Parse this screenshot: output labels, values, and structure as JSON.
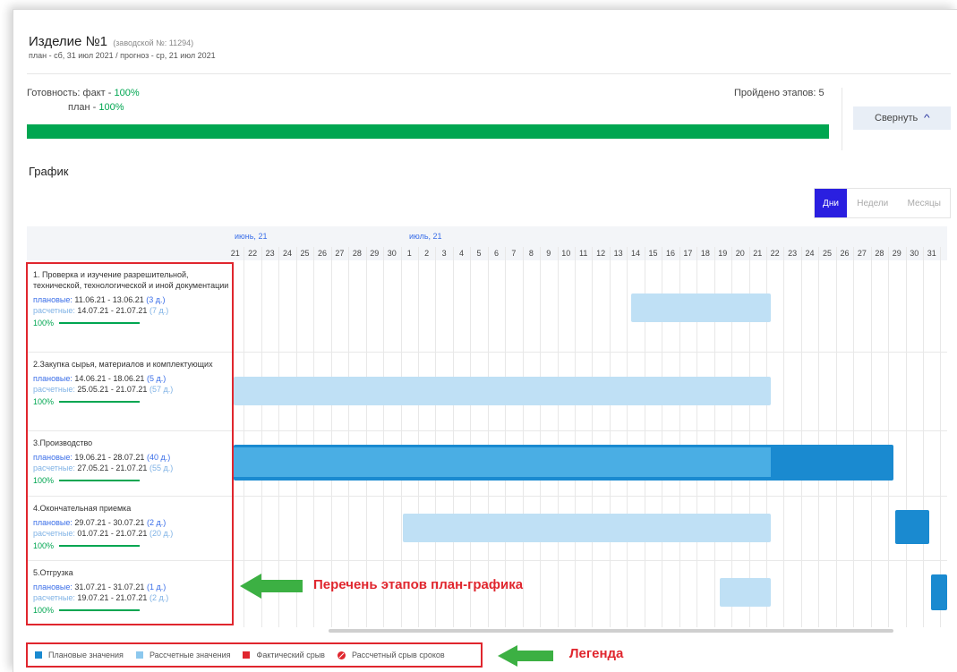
{
  "product": {
    "title": "Изделие №1",
    "serial": "(заводской №: 11294)",
    "dates": "план - сб, 31 июл 2021 / прогноз - ср, 21 июл 2021"
  },
  "readiness": {
    "fact_label": "Готовность: факт - ",
    "fact_value": "100%",
    "plan_label": "план - ",
    "plan_value": "100%",
    "stages_passed": "Пройдено этапов: 5",
    "progress": 1.0,
    "collapse_label": "Свернуть"
  },
  "schedule": {
    "title": "График",
    "views": [
      "Дни",
      "Недели",
      "Месяцы"
    ],
    "active_view": "Дни",
    "months": [
      "июнь, 21",
      "июль, 21"
    ],
    "days": [
      "21",
      "22",
      "23",
      "24",
      "25",
      "26",
      "27",
      "28",
      "29",
      "30",
      "1",
      "2",
      "3",
      "4",
      "5",
      "6",
      "7",
      "8",
      "9",
      "10",
      "11",
      "12",
      "13",
      "14",
      "15",
      "16",
      "17",
      "18",
      "19",
      "20",
      "21",
      "22",
      "23",
      "24",
      "25",
      "26",
      "27",
      "28",
      "29",
      "30",
      "31"
    ]
  },
  "stages": [
    {
      "name": "1. Проверка и изучение разрешительной, технической, технологической и иной документации",
      "plan_label": "плановые: ",
      "plan_range": "11.06.21 - 13.06.21",
      "plan_dur": "(3 д.)",
      "calc_label": "расчетные: ",
      "calc_range": "14.07.21 - 21.07.21",
      "calc_dur": "(7 д.)",
      "pct": "100%"
    },
    {
      "name": "2.Закупка сырья, материалов и комплектующих",
      "plan_label": "плановые: ",
      "plan_range": "14.06.21 - 18.06.21",
      "plan_dur": "(5 д.)",
      "calc_label": "расчетные: ",
      "calc_range": "25.05.21 - 21.07.21",
      "calc_dur": "(57 д.)",
      "pct": "100%"
    },
    {
      "name": "3.Производство",
      "plan_label": "плановые: ",
      "plan_range": "19.06.21 - 28.07.21",
      "plan_dur": "(40 д.)",
      "calc_label": "расчетные: ",
      "calc_range": "27.05.21 - 21.07.21",
      "calc_dur": "(55 д.)",
      "pct": "100%"
    },
    {
      "name": "4.Окончательная приемка",
      "plan_label": "плановые: ",
      "plan_range": "29.07.21 - 30.07.21",
      "plan_dur": "(2 д.)",
      "calc_label": "расчетные: ",
      "calc_range": "01.07.21 - 21.07.21",
      "calc_dur": "(20 д.)",
      "pct": "100%"
    },
    {
      "name": "5.Отгрузка",
      "plan_label": "плановые: ",
      "plan_range": "31.07.21 - 31.07.21",
      "plan_dur": "(1 д.)",
      "calc_label": "расчетные: ",
      "calc_range": "19.07.21 - 21.07.21",
      "calc_dur": "(2 д.)",
      "pct": "100%"
    }
  ],
  "annotations": {
    "stages_list": "Перечень этапов план-графика",
    "legend": "Легенда"
  },
  "legend": {
    "planned": "Плановые значения",
    "calculated": "Рассчетные значения",
    "actual_fail": "Фактический срыв",
    "calc_fail": "Рассчетный срыв сроков"
  },
  "colors": {
    "accent": "#2a1fe0",
    "green": "#00a651",
    "plan_bar": "#1a8ad0",
    "calc_bar": "#bfe0f5",
    "red": "#e0262e"
  },
  "icons": {
    "collapse": "chevron-up-icon",
    "annotation_arrow": "arrow-left-icon",
    "calc_fail": "crossed-circle-icon"
  }
}
